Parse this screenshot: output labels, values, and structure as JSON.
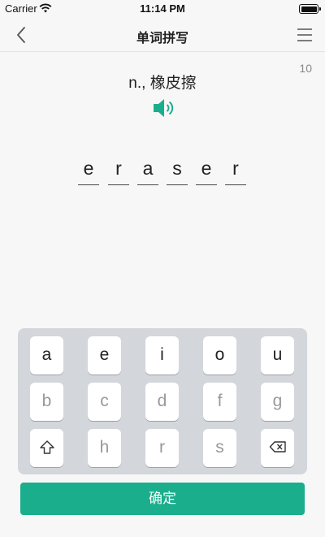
{
  "status_bar": {
    "carrier": "Carrier",
    "time": "11:14 PM"
  },
  "nav": {
    "title": "单词拼写"
  },
  "quiz": {
    "counter": "10",
    "definition": "n., 橡皮擦",
    "letters": [
      "e",
      "r",
      "a",
      "s",
      "e",
      "r"
    ]
  },
  "keyboard": {
    "rows": [
      [
        {
          "label": "a",
          "enabled": true
        },
        {
          "label": "e",
          "enabled": true
        },
        {
          "label": "i",
          "enabled": true
        },
        {
          "label": "o",
          "enabled": true
        },
        {
          "label": "u",
          "enabled": true
        }
      ],
      [
        {
          "label": "b",
          "enabled": false
        },
        {
          "label": "c",
          "enabled": false
        },
        {
          "label": "d",
          "enabled": false
        },
        {
          "label": "f",
          "enabled": false
        },
        {
          "label": "g",
          "enabled": false
        }
      ],
      [
        {
          "label": "shift",
          "enabled": true,
          "icon": "shift-icon"
        },
        {
          "label": "h",
          "enabled": false
        },
        {
          "label": "r",
          "enabled": false
        },
        {
          "label": "s",
          "enabled": false
        },
        {
          "label": "delete",
          "enabled": true,
          "icon": "delete-icon"
        }
      ]
    ]
  },
  "confirm": {
    "label": "确定"
  },
  "colors": {
    "accent": "#1aae8c",
    "keyboard_bg": "#d3d6db"
  }
}
